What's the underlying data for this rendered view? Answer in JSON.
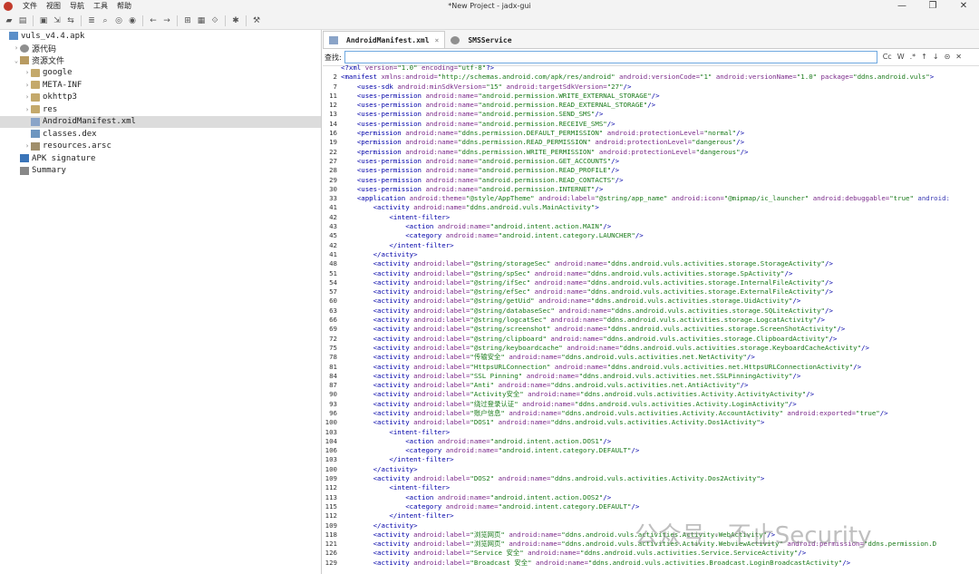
{
  "window": {
    "title": "*New Project - jadx-gui",
    "menu": [
      "文件",
      "视图",
      "导航",
      "工具",
      "帮助"
    ],
    "controls": [
      "—",
      "❐",
      "✕"
    ]
  },
  "toolbar": {
    "icons": [
      "open-icon",
      "add-icon",
      "save-icon",
      "export-icon",
      "sync-icon",
      "flat-pkg-icon",
      "search-icon",
      "search-class-icon",
      "search-usage-icon",
      "back-icon",
      "forward-icon",
      "quark-icon",
      "log-icon",
      "deobf-icon",
      "debug-icon",
      "prefs-icon"
    ]
  },
  "tree": [
    {
      "label": "vuls_v4.4.apk",
      "indent": 0,
      "twisty": "",
      "icon": "apk"
    },
    {
      "label": "源代码",
      "indent": 1,
      "twisty": "›",
      "icon": "src"
    },
    {
      "label": "资源文件",
      "indent": 1,
      "twisty": "⌄",
      "icon": "res"
    },
    {
      "label": "google",
      "indent": 2,
      "twisty": "›",
      "icon": "folder"
    },
    {
      "label": "META-INF",
      "indent": 2,
      "twisty": "›",
      "icon": "folder"
    },
    {
      "label": "okhttp3",
      "indent": 2,
      "twisty": "›",
      "icon": "folder"
    },
    {
      "label": "res",
      "indent": 2,
      "twisty": "›",
      "icon": "folder"
    },
    {
      "label": "AndroidManifest.xml",
      "indent": 2,
      "twisty": "",
      "icon": "xml",
      "selected": true
    },
    {
      "label": "classes.dex",
      "indent": 2,
      "twisty": "",
      "icon": "dex"
    },
    {
      "label": "resources.arsc",
      "indent": 2,
      "twisty": "›",
      "icon": "arsc"
    },
    {
      "label": "APK signature",
      "indent": 1,
      "twisty": "",
      "icon": "sig"
    },
    {
      "label": "Summary",
      "indent": 1,
      "twisty": "",
      "icon": "sum"
    }
  ],
  "tabs": [
    {
      "label": "AndroidManifest.xml",
      "active": true
    },
    {
      "label": "SMSService",
      "active": false
    }
  ],
  "search": {
    "label": "查找:",
    "value": "",
    "options": [
      "Cc",
      "W",
      ".*",
      "↑",
      "↓",
      "⊝",
      "✕"
    ]
  },
  "code": [
    {
      "n": "",
      "t": "<?xml version=\"1.0\" encoding=\"utf-8\"?>"
    },
    {
      "n": "2",
      "t": "<manifest xmlns:android=\"http://schemas.android.com/apk/res/android\" android:versionCode=\"1\" android:versionName=\"1.0\" package=\"ddns.android.vuls\">"
    },
    {
      "n": "7",
      "t": "    <uses-sdk android:minSdkVersion=\"15\" android:targetSdkVersion=\"27\"/>"
    },
    {
      "n": "11",
      "t": "    <uses-permission android:name=\"android.permission.WRITE_EXTERNAL_STORAGE\"/>"
    },
    {
      "n": "12",
      "t": "    <uses-permission android:name=\"android.permission.READ_EXTERNAL_STORAGE\"/>"
    },
    {
      "n": "13",
      "t": "    <uses-permission android:name=\"android.permission.SEND_SMS\"/>"
    },
    {
      "n": "14",
      "t": "    <uses-permission android:name=\"android.permission.RECEIVE_SMS\"/>"
    },
    {
      "n": "16",
      "t": "    <permission android:name=\"ddns.permission.DEFAULT_PERMISSION\" android:protectionLevel=\"normal\"/>"
    },
    {
      "n": "19",
      "t": "    <permission android:name=\"ddns.permission.READ_PERMISSION\" android:protectionLevel=\"dangerous\"/>"
    },
    {
      "n": "22",
      "t": "    <permission android:name=\"ddns.permission.WRITE_PERMISSION\" android:protectionLevel=\"dangerous\"/>"
    },
    {
      "n": "27",
      "t": "    <uses-permission android:name=\"android.permission.GET_ACCOUNTS\"/>"
    },
    {
      "n": "28",
      "t": "    <uses-permission android:name=\"android.permission.READ_PROFILE\"/>"
    },
    {
      "n": "29",
      "t": "    <uses-permission android:name=\"android.permission.READ_CONTACTS\"/>"
    },
    {
      "n": "30",
      "t": "    <uses-permission android:name=\"android.permission.INTERNET\"/>"
    },
    {
      "n": "33",
      "t": "    <application android:theme=\"@style/AppTheme\" android:label=\"@string/app_name\" android:icon=\"@mipmap/ic_launcher\" android:debuggable=\"true\" android:"
    },
    {
      "n": "41",
      "t": "        <activity android:name=\"ddns.android.vuls.MainActivity\">"
    },
    {
      "n": "42",
      "t": "            <intent-filter>"
    },
    {
      "n": "43",
      "t": "                <action android:name=\"android.intent.action.MAIN\"/>"
    },
    {
      "n": "45",
      "t": "                <category android:name=\"android.intent.category.LAUNCHER\"/>"
    },
    {
      "n": "42",
      "t": "            </intent-filter>"
    },
    {
      "n": "41",
      "t": "        </activity>"
    },
    {
      "n": "48",
      "t": "        <activity android:label=\"@string/storageSec\" android:name=\"ddns.android.vuls.activities.storage.StorageActivity\"/>"
    },
    {
      "n": "51",
      "t": "        <activity android:label=\"@string/spSec\" android:name=\"ddns.android.vuls.activities.storage.SpActivity\"/>"
    },
    {
      "n": "54",
      "t": "        <activity android:label=\"@string/ifSec\" android:name=\"ddns.android.vuls.activities.storage.InternalFileActivity\"/>"
    },
    {
      "n": "57",
      "t": "        <activity android:label=\"@string/efSec\" android:name=\"ddns.android.vuls.activities.storage.ExternalFileActivity\"/>"
    },
    {
      "n": "60",
      "t": "        <activity android:label=\"@string/getUid\" android:name=\"ddns.android.vuls.activities.storage.UidActivity\"/>"
    },
    {
      "n": "63",
      "t": "        <activity android:label=\"@string/databaseSec\" android:name=\"ddns.android.vuls.activities.storage.SQLiteActivity\"/>"
    },
    {
      "n": "66",
      "t": "        <activity android:label=\"@string/logcatSec\" android:name=\"ddns.android.vuls.activities.storage.LogcatActivity\"/>"
    },
    {
      "n": "69",
      "t": "        <activity android:label=\"@string/screenshot\" android:name=\"ddns.android.vuls.activities.storage.ScreenShotActivity\"/>"
    },
    {
      "n": "72",
      "t": "        <activity android:label=\"@string/clipboard\" android:name=\"ddns.android.vuls.activities.storage.ClipboardActivity\"/>"
    },
    {
      "n": "75",
      "t": "        <activity android:label=\"@string/keyboardcache\" android:name=\"ddns.android.vuls.activities.storage.KeyboardCacheActivity\"/>"
    },
    {
      "n": "78",
      "t": "        <activity android:label=\"传输安全\" android:name=\"ddns.android.vuls.activities.net.NetActivity\"/>"
    },
    {
      "n": "81",
      "t": "        <activity android:label=\"HttpsURLConnection\" android:name=\"ddns.android.vuls.activities.net.HttpsURLConnectionActivity\"/>"
    },
    {
      "n": "84",
      "t": "        <activity android:label=\"SSL Pinning\" android:name=\"ddns.android.vuls.activities.net.SSLPinningActivity\"/>"
    },
    {
      "n": "87",
      "t": "        <activity android:label=\"Anti\" android:name=\"ddns.android.vuls.activities.net.AntiActivity\"/>"
    },
    {
      "n": "90",
      "t": "        <activity android:label=\"Activity安全\" android:name=\"ddns.android.vuls.activities.Activity.ActivityActivity\"/>"
    },
    {
      "n": "93",
      "t": "        <activity android:label=\"绕过登录认证\" android:name=\"ddns.android.vuls.activities.Activity.LoginActivity\"/>"
    },
    {
      "n": "96",
      "t": "        <activity android:label=\"账户信息\" android:name=\"ddns.android.vuls.activities.Activity.AccountActivity\" android:exported=\"true\"/>"
    },
    {
      "n": "100",
      "t": "        <activity android:label=\"DOS1\" android:name=\"ddns.android.vuls.activities.Activity.Dos1Activity\">"
    },
    {
      "n": "103",
      "t": "            <intent-filter>"
    },
    {
      "n": "104",
      "t": "                <action android:name=\"android.intent.action.DOS1\"/>"
    },
    {
      "n": "106",
      "t": "                <category android:name=\"android.intent.category.DEFAULT\"/>"
    },
    {
      "n": "103",
      "t": "            </intent-filter>"
    },
    {
      "n": "100",
      "t": "        </activity>"
    },
    {
      "n": "109",
      "t": "        <activity android:label=\"DOS2\" android:name=\"ddns.android.vuls.activities.Activity.Dos2Activity\">"
    },
    {
      "n": "112",
      "t": "            <intent-filter>"
    },
    {
      "n": "113",
      "t": "                <action android:name=\"android.intent.action.DOS2\"/>"
    },
    {
      "n": "115",
      "t": "                <category android:name=\"android.intent.category.DEFAULT\"/>"
    },
    {
      "n": "112",
      "t": "            </intent-filter>"
    },
    {
      "n": "109",
      "t": "        </activity>"
    },
    {
      "n": "118",
      "t": "        <activity android:label=\"浏览网页\" android:name=\"ddns.android.vuls.activities.Activity.WebActivity\"/>"
    },
    {
      "n": "121",
      "t": "        <activity android:label=\"浏览网页\" android:name=\"ddns.android.vuls.activities.Activity.WebviewActivity\" android:permission=\"ddns.permission.D"
    },
    {
      "n": "126",
      "t": "        <activity android:label=\"Service 安全\" android:name=\"ddns.android.vuls.activities.Service.ServiceActivity\"/>"
    },
    {
      "n": "129",
      "t": "        <activity android:label=\"Broadcast 安全\" android:name=\"ddns.android.vuls.activities.Broadcast.LoginBroadcastActivity\"/>"
    }
  ],
  "watermark": "公众号 · 不止Security"
}
